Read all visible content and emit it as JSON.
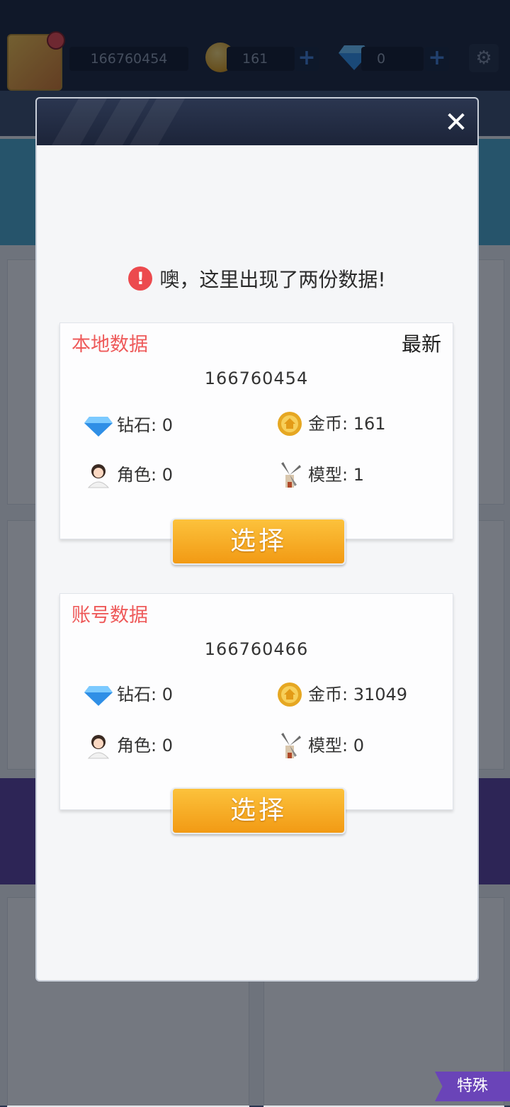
{
  "topbar": {
    "player_id": "166760454",
    "coins": "161",
    "gems": "0"
  },
  "background": {
    "special_tab": "特殊"
  },
  "dialog": {
    "warning_text": "噢，这里出现了两份数据!",
    "local": {
      "title": "本地数据",
      "badge": "最新",
      "id": "166760454",
      "gems": "钻石: 0",
      "coins": "金币: 161",
      "roles": "角色: 0",
      "models": "模型: 1",
      "select_label": "选择"
    },
    "account": {
      "title": "账号数据",
      "id": "166760466",
      "gems": "钻石: 0",
      "coins": "金币: 31049",
      "roles": "角色: 0",
      "models": "模型: 0",
      "select_label": "选择"
    }
  },
  "colors": {
    "accent_orange": "#f29a14",
    "title_red": "#ee5a5a",
    "warning_red": "#ec4a4e"
  }
}
